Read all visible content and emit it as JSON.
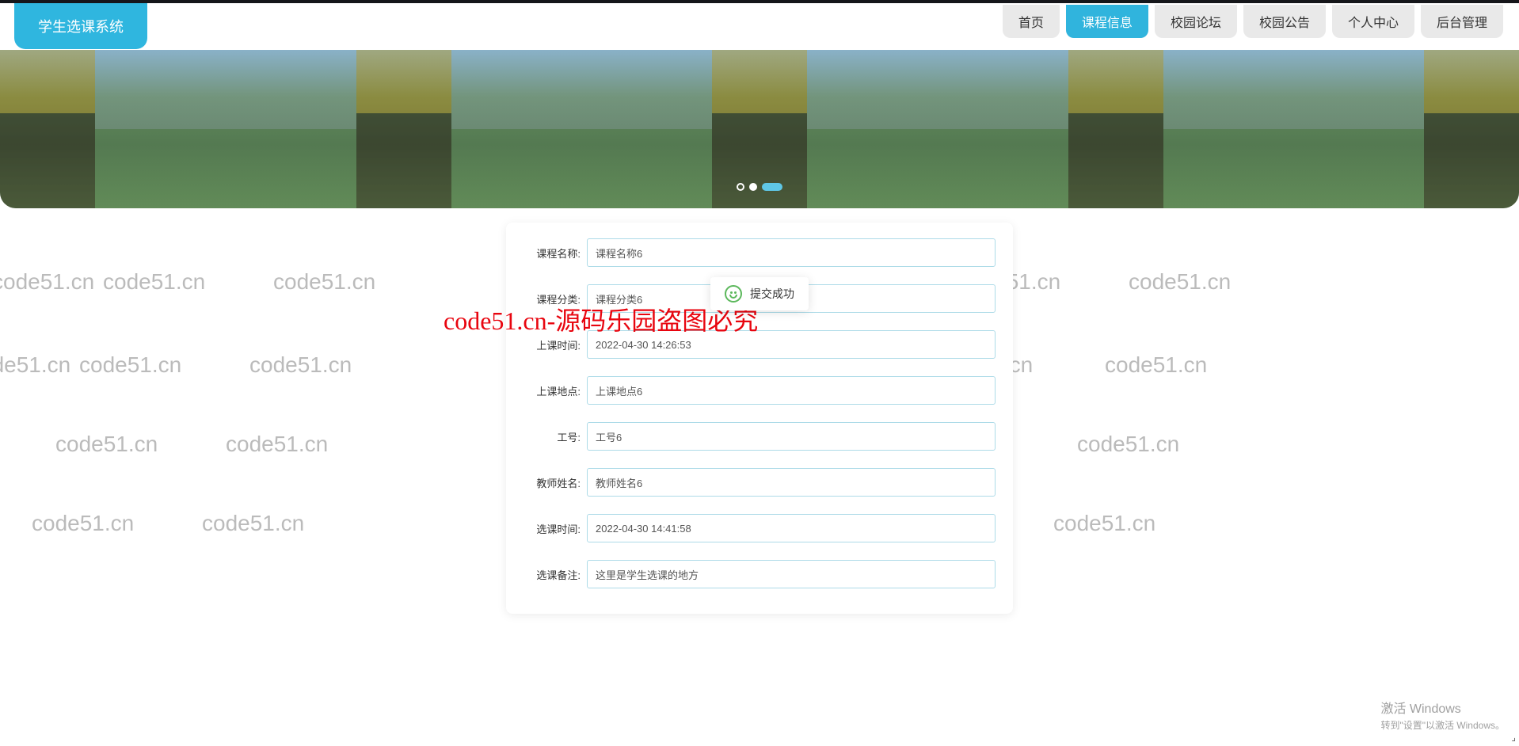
{
  "app_title": "学生选课系统",
  "nav": [
    {
      "label": "首页",
      "active": false
    },
    {
      "label": "课程信息",
      "active": true
    },
    {
      "label": "校园论坛",
      "active": false
    },
    {
      "label": "校园公告",
      "active": false
    },
    {
      "label": "个人中心",
      "active": false
    },
    {
      "label": "后台管理",
      "active": false
    }
  ],
  "toast_message": "提交成功",
  "form": {
    "fields": [
      {
        "label": "课程名称:",
        "value": "课程名称6"
      },
      {
        "label": "课程分类:",
        "value": "课程分类6"
      },
      {
        "label": "上课时间:",
        "value": "2022-04-30 14:26:53"
      },
      {
        "label": "上课地点:",
        "value": "上课地点6"
      },
      {
        "label": "工号:",
        "value": "工号6"
      },
      {
        "label": "教师姓名:",
        "value": "教师姓名6"
      },
      {
        "label": "选课时间:",
        "value": "2022-04-30 14:41:58"
      },
      {
        "label": "选课备注:",
        "value": "这里是学生选课的地方"
      }
    ]
  },
  "watermark_text": "code51.cn",
  "watermark_red": "code51.cn-源码乐园盗图必究",
  "activate": {
    "title": "激活 Windows",
    "subtitle": "转到\"设置\"以激活 Windows。"
  }
}
